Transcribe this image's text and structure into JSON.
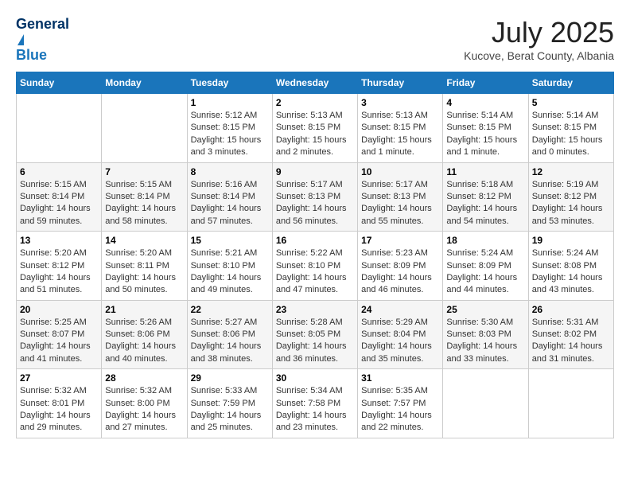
{
  "header": {
    "logo_general": "General",
    "logo_blue": "Blue",
    "month_title": "July 2025",
    "subtitle": "Kucove, Berat County, Albania"
  },
  "weekdays": [
    "Sunday",
    "Monday",
    "Tuesday",
    "Wednesday",
    "Thursday",
    "Friday",
    "Saturday"
  ],
  "weeks": [
    [
      {
        "day": "",
        "sunrise": "",
        "sunset": "",
        "daylight": ""
      },
      {
        "day": "",
        "sunrise": "",
        "sunset": "",
        "daylight": ""
      },
      {
        "day": "1",
        "sunrise": "Sunrise: 5:12 AM",
        "sunset": "Sunset: 8:15 PM",
        "daylight": "Daylight: 15 hours and 3 minutes."
      },
      {
        "day": "2",
        "sunrise": "Sunrise: 5:13 AM",
        "sunset": "Sunset: 8:15 PM",
        "daylight": "Daylight: 15 hours and 2 minutes."
      },
      {
        "day": "3",
        "sunrise": "Sunrise: 5:13 AM",
        "sunset": "Sunset: 8:15 PM",
        "daylight": "Daylight: 15 hours and 1 minute."
      },
      {
        "day": "4",
        "sunrise": "Sunrise: 5:14 AM",
        "sunset": "Sunset: 8:15 PM",
        "daylight": "Daylight: 15 hours and 1 minute."
      },
      {
        "day": "5",
        "sunrise": "Sunrise: 5:14 AM",
        "sunset": "Sunset: 8:15 PM",
        "daylight": "Daylight: 15 hours and 0 minutes."
      }
    ],
    [
      {
        "day": "6",
        "sunrise": "Sunrise: 5:15 AM",
        "sunset": "Sunset: 8:14 PM",
        "daylight": "Daylight: 14 hours and 59 minutes."
      },
      {
        "day": "7",
        "sunrise": "Sunrise: 5:15 AM",
        "sunset": "Sunset: 8:14 PM",
        "daylight": "Daylight: 14 hours and 58 minutes."
      },
      {
        "day": "8",
        "sunrise": "Sunrise: 5:16 AM",
        "sunset": "Sunset: 8:14 PM",
        "daylight": "Daylight: 14 hours and 57 minutes."
      },
      {
        "day": "9",
        "sunrise": "Sunrise: 5:17 AM",
        "sunset": "Sunset: 8:13 PM",
        "daylight": "Daylight: 14 hours and 56 minutes."
      },
      {
        "day": "10",
        "sunrise": "Sunrise: 5:17 AM",
        "sunset": "Sunset: 8:13 PM",
        "daylight": "Daylight: 14 hours and 55 minutes."
      },
      {
        "day": "11",
        "sunrise": "Sunrise: 5:18 AM",
        "sunset": "Sunset: 8:12 PM",
        "daylight": "Daylight: 14 hours and 54 minutes."
      },
      {
        "day": "12",
        "sunrise": "Sunrise: 5:19 AM",
        "sunset": "Sunset: 8:12 PM",
        "daylight": "Daylight: 14 hours and 53 minutes."
      }
    ],
    [
      {
        "day": "13",
        "sunrise": "Sunrise: 5:20 AM",
        "sunset": "Sunset: 8:12 PM",
        "daylight": "Daylight: 14 hours and 51 minutes."
      },
      {
        "day": "14",
        "sunrise": "Sunrise: 5:20 AM",
        "sunset": "Sunset: 8:11 PM",
        "daylight": "Daylight: 14 hours and 50 minutes."
      },
      {
        "day": "15",
        "sunrise": "Sunrise: 5:21 AM",
        "sunset": "Sunset: 8:10 PM",
        "daylight": "Daylight: 14 hours and 49 minutes."
      },
      {
        "day": "16",
        "sunrise": "Sunrise: 5:22 AM",
        "sunset": "Sunset: 8:10 PM",
        "daylight": "Daylight: 14 hours and 47 minutes."
      },
      {
        "day": "17",
        "sunrise": "Sunrise: 5:23 AM",
        "sunset": "Sunset: 8:09 PM",
        "daylight": "Daylight: 14 hours and 46 minutes."
      },
      {
        "day": "18",
        "sunrise": "Sunrise: 5:24 AM",
        "sunset": "Sunset: 8:09 PM",
        "daylight": "Daylight: 14 hours and 44 minutes."
      },
      {
        "day": "19",
        "sunrise": "Sunrise: 5:24 AM",
        "sunset": "Sunset: 8:08 PM",
        "daylight": "Daylight: 14 hours and 43 minutes."
      }
    ],
    [
      {
        "day": "20",
        "sunrise": "Sunrise: 5:25 AM",
        "sunset": "Sunset: 8:07 PM",
        "daylight": "Daylight: 14 hours and 41 minutes."
      },
      {
        "day": "21",
        "sunrise": "Sunrise: 5:26 AM",
        "sunset": "Sunset: 8:06 PM",
        "daylight": "Daylight: 14 hours and 40 minutes."
      },
      {
        "day": "22",
        "sunrise": "Sunrise: 5:27 AM",
        "sunset": "Sunset: 8:06 PM",
        "daylight": "Daylight: 14 hours and 38 minutes."
      },
      {
        "day": "23",
        "sunrise": "Sunrise: 5:28 AM",
        "sunset": "Sunset: 8:05 PM",
        "daylight": "Daylight: 14 hours and 36 minutes."
      },
      {
        "day": "24",
        "sunrise": "Sunrise: 5:29 AM",
        "sunset": "Sunset: 8:04 PM",
        "daylight": "Daylight: 14 hours and 35 minutes."
      },
      {
        "day": "25",
        "sunrise": "Sunrise: 5:30 AM",
        "sunset": "Sunset: 8:03 PM",
        "daylight": "Daylight: 14 hours and 33 minutes."
      },
      {
        "day": "26",
        "sunrise": "Sunrise: 5:31 AM",
        "sunset": "Sunset: 8:02 PM",
        "daylight": "Daylight: 14 hours and 31 minutes."
      }
    ],
    [
      {
        "day": "27",
        "sunrise": "Sunrise: 5:32 AM",
        "sunset": "Sunset: 8:01 PM",
        "daylight": "Daylight: 14 hours and 29 minutes."
      },
      {
        "day": "28",
        "sunrise": "Sunrise: 5:32 AM",
        "sunset": "Sunset: 8:00 PM",
        "daylight": "Daylight: 14 hours and 27 minutes."
      },
      {
        "day": "29",
        "sunrise": "Sunrise: 5:33 AM",
        "sunset": "Sunset: 7:59 PM",
        "daylight": "Daylight: 14 hours and 25 minutes."
      },
      {
        "day": "30",
        "sunrise": "Sunrise: 5:34 AM",
        "sunset": "Sunset: 7:58 PM",
        "daylight": "Daylight: 14 hours and 23 minutes."
      },
      {
        "day": "31",
        "sunrise": "Sunrise: 5:35 AM",
        "sunset": "Sunset: 7:57 PM",
        "daylight": "Daylight: 14 hours and 22 minutes."
      },
      {
        "day": "",
        "sunrise": "",
        "sunset": "",
        "daylight": ""
      },
      {
        "day": "",
        "sunrise": "",
        "sunset": "",
        "daylight": ""
      }
    ]
  ]
}
